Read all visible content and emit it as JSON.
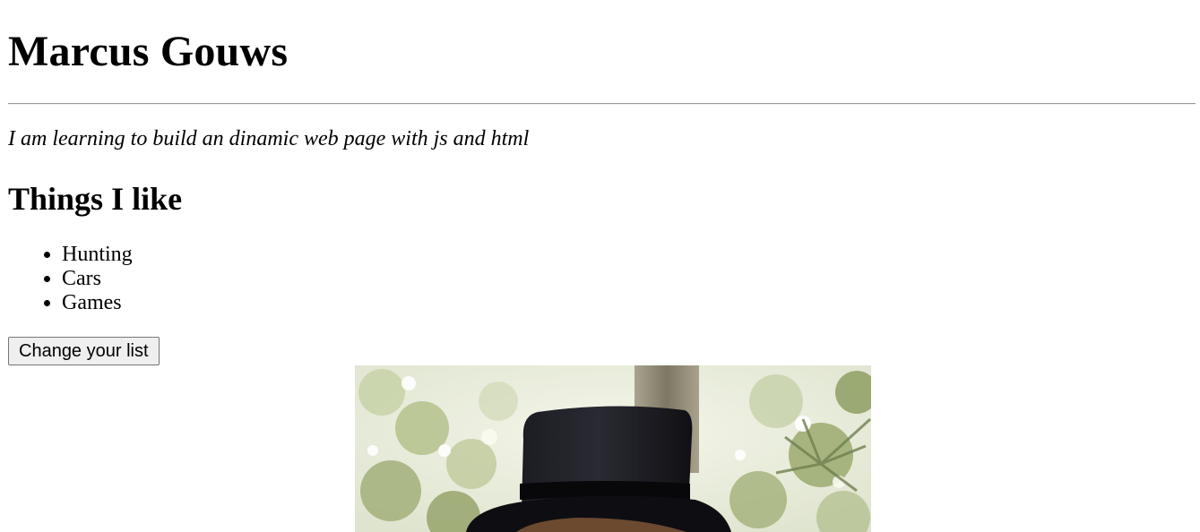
{
  "header": {
    "name": "Marcus Gouws"
  },
  "intro": {
    "tagline": "I am learning to build an dinamic web page with js and html"
  },
  "likes": {
    "heading": "Things I like",
    "items": [
      "Hunting",
      "Cars",
      "Games"
    ]
  },
  "actions": {
    "change_label": "Change your list"
  },
  "photo": {
    "icon": "portrait-photo",
    "colors": {
      "foliage_light": "#e8eed6",
      "foliage_dark": "#7f8f5a",
      "trunk": "#8c8672",
      "hat": "#15151a",
      "hat_band": "#0a0a0d",
      "hair": "#6b4a30"
    }
  }
}
